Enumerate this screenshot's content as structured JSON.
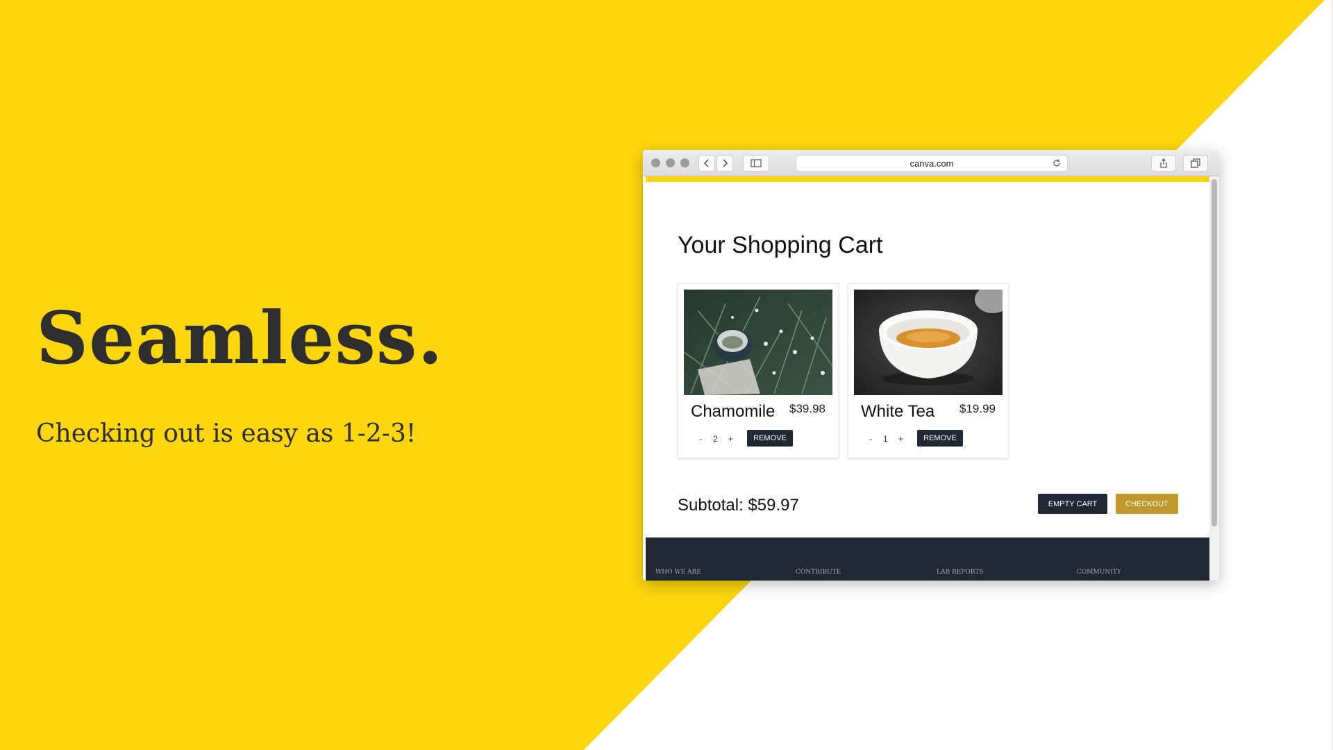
{
  "slide": {
    "headline": "Seamless.",
    "subline": "Checking out is easy as 1-2-3!",
    "accent_color": "#FDD60E",
    "text_color": "#2e2e2e"
  },
  "browser": {
    "url": "canva.com",
    "icons": [
      "back-icon",
      "forward-icon",
      "sidebar-icon",
      "reload-icon",
      "share-icon",
      "tabs-icon"
    ]
  },
  "cart": {
    "title": "Your Shopping Cart",
    "items": [
      {
        "name": "Chamomile",
        "price": "$39.98",
        "minus": "-",
        "quantity": "2",
        "plus": "+",
        "remove_label": "REMOVE"
      },
      {
        "name": "White Tea",
        "price": "$19.99",
        "minus": "-",
        "quantity": "1",
        "plus": "+",
        "remove_label": "REMOVE"
      }
    ],
    "subtotal": "Subtotal: $59.97",
    "empty_label": "EMPTY CART",
    "checkout_label": "CHECKOUT",
    "checkout_color": "#C19A2E",
    "button_color": "#1f2833"
  },
  "footer": {
    "links": [
      "WHO WE ARE",
      "CONTRIBUTE",
      "LAB REPORTS",
      "COMMUNITY"
    ]
  }
}
